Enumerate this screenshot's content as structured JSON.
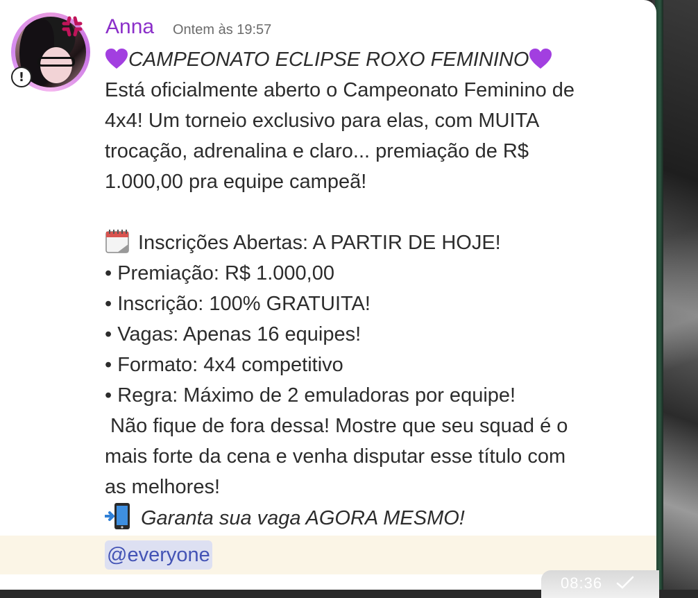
{
  "message": {
    "author": "Anna",
    "timestamp": "Ontem às 19:57",
    "title": "CAMPEONATO ECLIPSE ROXO FEMININO",
    "intro_lines": [
      "Está oficialmente aberto o Campeonato Feminino de",
      "4x4! Um torneio exclusivo para elas, com MUITA",
      "trocação, adrenalina e claro... premiação de R$",
      "1.000,00 pra equipe campeã!"
    ],
    "registration_line": "Inscrições Abertas: A PARTIR DE HOJE!",
    "bullets": [
      "• Premiação: R$ 1.000,00",
      "• Inscrição: 100% GRATUITA!",
      "• Vagas: Apenas 16 equipes!",
      "• Formato: 4x4 competitivo",
      "• Regra: Máximo de 2 emuladoras por equipe!"
    ],
    "closing_lines": [
      " Não fique de fora dessa! Mostre que seu squad é o",
      "mais forte da cena e venha disputar esse título com",
      "as melhores!"
    ],
    "cta": "Garanta sua vaga AGORA MESMO!",
    "mention": "@everyone"
  },
  "overlay": {
    "time": "08:36"
  },
  "icons": {
    "title_left": "purple-heart-icon",
    "title_right": "purple-heart-icon",
    "registration": "calendar-icon",
    "cta": "mobile-phone-arrow-icon",
    "avatar_badge": "anger-symbol-icon",
    "avatar_status": "warning-icon"
  },
  "colors": {
    "author": "#8b2fc9",
    "mention_text": "#4353b5",
    "mention_bg": "#dde0f2",
    "heart": "#a23fe0"
  }
}
